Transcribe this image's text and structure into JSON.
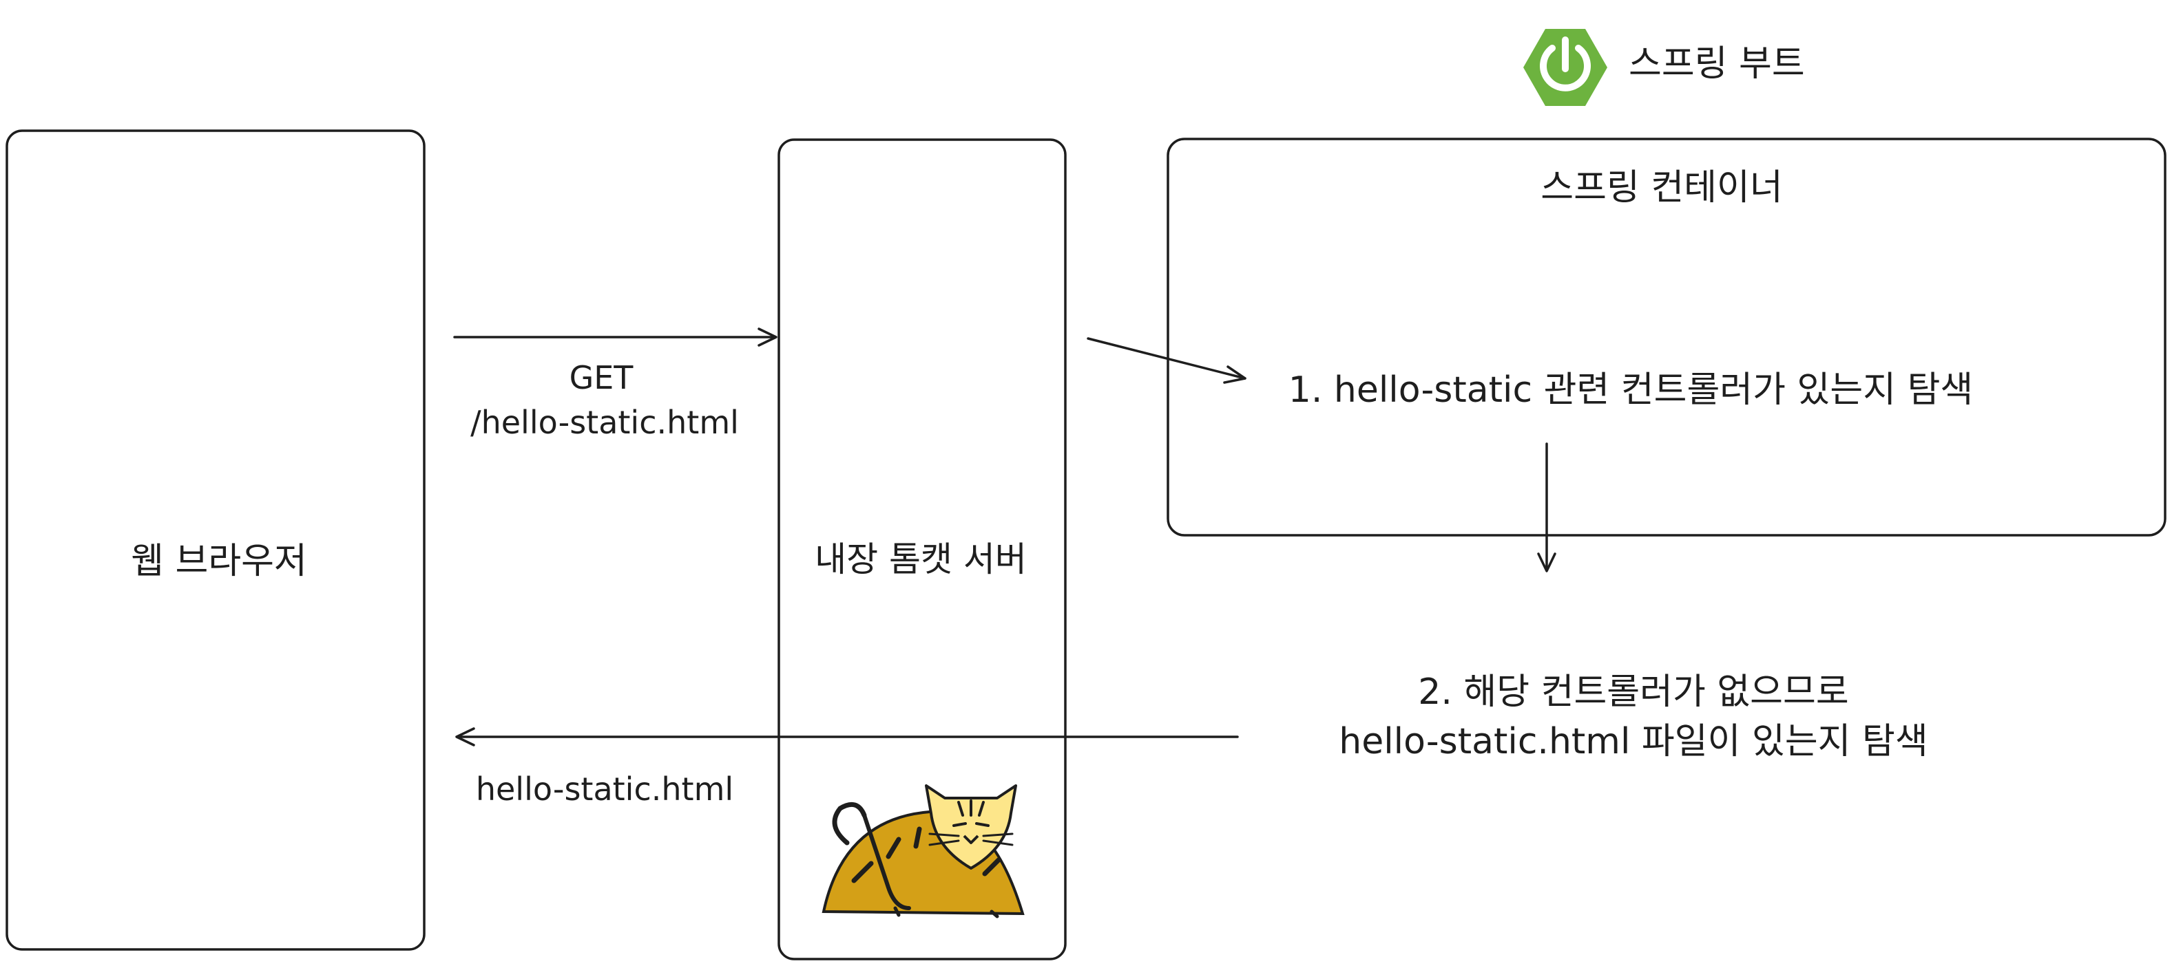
{
  "header": {
    "brand_label": "스프링 부트",
    "brand_icon": "spring-power-icon",
    "brand_color": "#6db33f"
  },
  "nodes": {
    "browser": {
      "label": "웹 브라우저"
    },
    "tomcat": {
      "label": "내장 톰캣 서버",
      "icon": "tomcat-icon"
    },
    "container": {
      "label": "스프링 컨테이너"
    }
  },
  "steps": {
    "step1": "1. hello-static 관련 컨트롤러가 있는지 탐색",
    "step2_line1": "2. 해당 컨트롤러가 없으므로",
    "step2_line2": "hello-static.html 파일이 있는지 탐색"
  },
  "edges": {
    "request_line1": "GET",
    "request_line2": "/hello-static.html",
    "response": "hello-static.html"
  }
}
